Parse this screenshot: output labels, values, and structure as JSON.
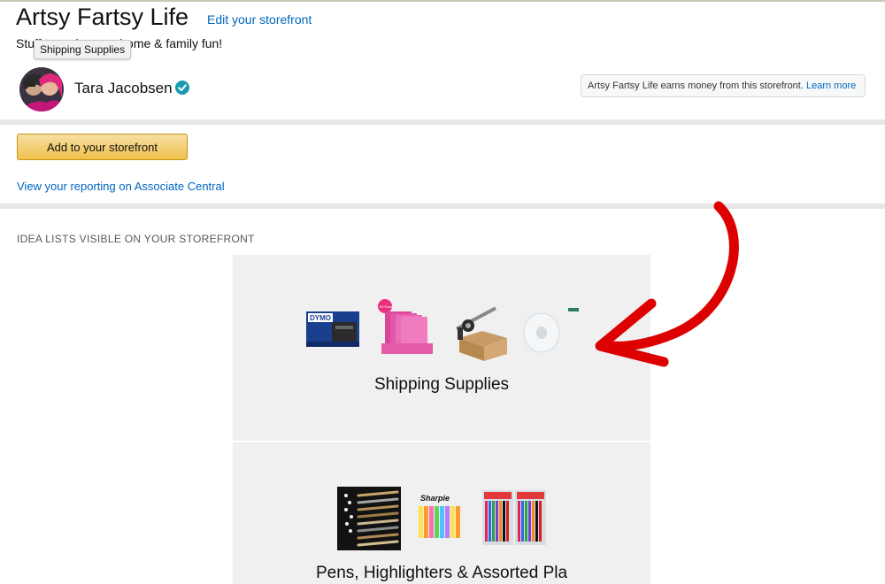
{
  "store": {
    "title": "Artsy Fartsy Life",
    "edit_link": "Edit your storefront",
    "tagline": "Stuff to make your home & family fun!"
  },
  "tooltip": {
    "text": "Shipping Supplies"
  },
  "profile": {
    "name": "Tara Jacobsen",
    "verified_icon": "check-badge-icon"
  },
  "earnings_notice": {
    "text": "Artsy Fartsy Life earns money from this storefront.",
    "link": "Learn more"
  },
  "actions": {
    "add_button": "Add to your storefront",
    "reporting_link": "View your reporting on Associate Central"
  },
  "idea_lists": {
    "heading": "IDEA LISTS VISIBLE ON YOUR STOREFRONT",
    "lists": [
      {
        "title": "Shipping Supplies",
        "thumb_brand": "DYMO",
        "thumb_badge": "50 Pack"
      },
      {
        "title": "Pens, Highlighters & Assorted Pla",
        "thumb_brand": "Sharpie"
      }
    ]
  },
  "colors": {
    "link": "#0066c0",
    "button_top": "#f7dfa5",
    "button_bottom": "#f0c14b",
    "verified": "#1a9bb0",
    "annotation_arrow": "#dd0000"
  }
}
